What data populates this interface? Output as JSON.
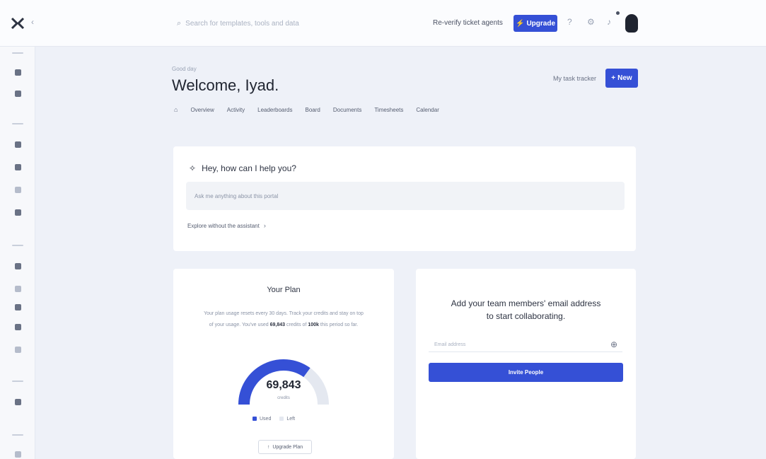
{
  "topbar": {
    "search_placeholder": "Search for templates, tools and data",
    "sales_link": "Re-verify ticket agents",
    "upgrade_label": "Upgrade",
    "upgrade_icon": "bolt-icon",
    "icons": [
      "help-icon",
      "settings-icon",
      "bell-icon"
    ]
  },
  "sidebar": {
    "icons": [
      "home-icon",
      "inbox-icon",
      "grid-icon",
      "doc-icon",
      "list-icon",
      "calendar-icon",
      "chart-icon",
      "folder-icon",
      "user-icon",
      "tag-icon",
      "star-icon",
      "settings-icon",
      "help-icon"
    ]
  },
  "header": {
    "greeting": "Good day",
    "welcome": "Welcome, Iyad.",
    "tasks_link": "My task tracker",
    "new_button": "New",
    "tabs": [
      "Overview",
      "Activity",
      "Leaderboards",
      "Board",
      "Documents",
      "Timesheets",
      "Calendar"
    ]
  },
  "help": {
    "title": "Hey, how can I help you?",
    "input_placeholder": "Ask me anything about this portal",
    "link": "Explore without the assistant"
  },
  "plan": {
    "title": "Your Plan",
    "desc_line1": "Your plan usage resets every 30 days. Track your credits and stay on top",
    "desc_pre": "of your usage. You've used",
    "desc_used": "69,843",
    "desc_mid": "credits of",
    "desc_total": "100k",
    "desc_post": "this period so far.",
    "gauge_value": "69,843",
    "gauge_unit": "credits",
    "gauge_fraction": 0.7,
    "legend_used": "Used",
    "legend_left": "Left",
    "button_label": "Upgrade Plan",
    "colors": {
      "used": "#3550d6",
      "left": "#e4e8f0"
    }
  },
  "team": {
    "title_line1": "Add your team members' email address",
    "title_line2": "to start collaborating.",
    "input_placeholder": "Email address",
    "button_label": "Invite People"
  }
}
